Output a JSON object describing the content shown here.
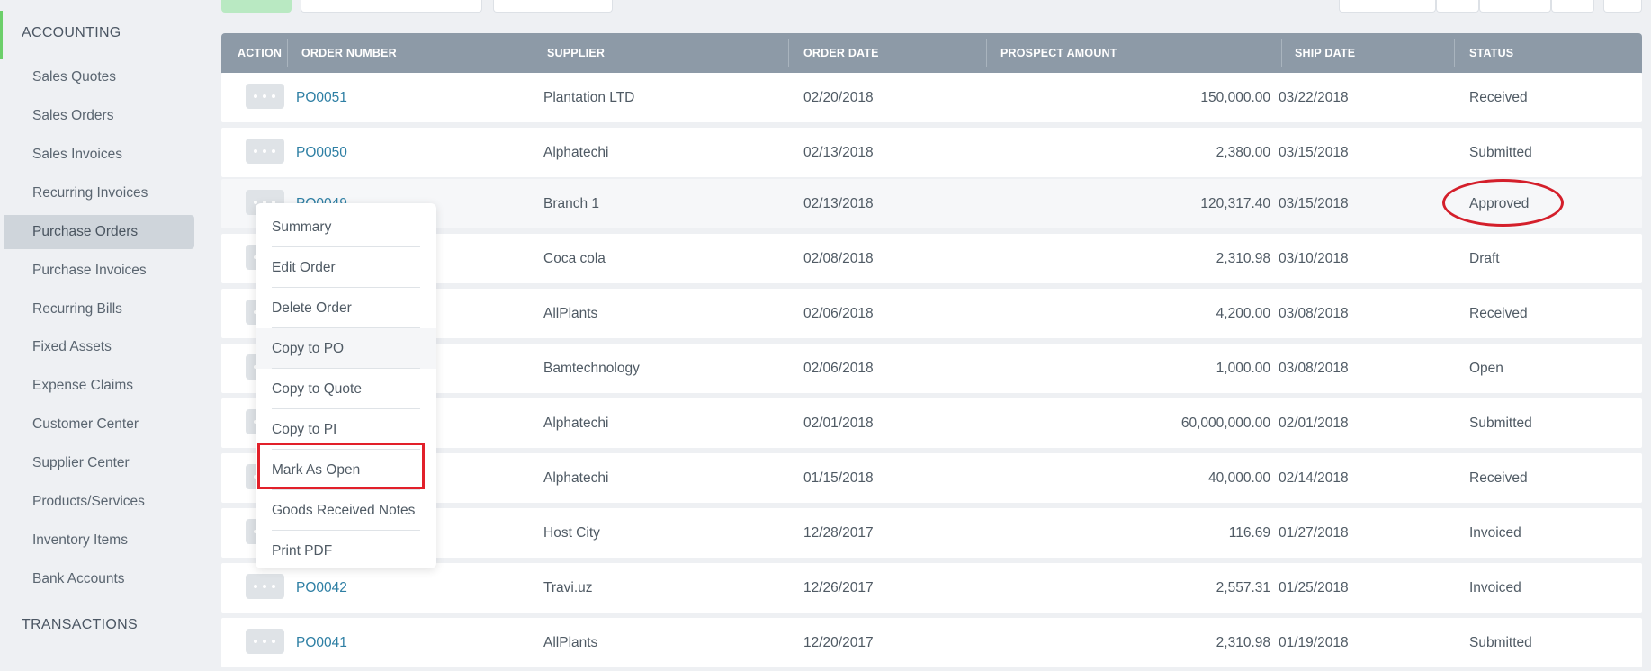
{
  "sidebar": {
    "section_accounting": "ACCOUNTING",
    "section_transactions": "TRANSACTIONS",
    "items": [
      {
        "label": "Sales Quotes"
      },
      {
        "label": "Sales Orders"
      },
      {
        "label": "Sales Invoices"
      },
      {
        "label": "Recurring Invoices"
      },
      {
        "label": "Purchase Orders",
        "active": true
      },
      {
        "label": "Purchase Invoices"
      },
      {
        "label": "Recurring Bills"
      },
      {
        "label": "Fixed Assets"
      },
      {
        "label": "Expense Claims"
      },
      {
        "label": "Customer Center"
      },
      {
        "label": "Supplier Center"
      },
      {
        "label": "Products/Services"
      },
      {
        "label": "Inventory Items"
      },
      {
        "label": "Bank Accounts"
      }
    ]
  },
  "table": {
    "columns": {
      "action": "ACTION",
      "order_number": "ORDER NUMBER",
      "supplier": "SUPPLIER",
      "order_date": "ORDER DATE",
      "prospect_amount": "PROSPECT AMOUNT",
      "ship_date": "SHIP DATE",
      "status": "STATUS"
    },
    "rows": [
      {
        "order": "PO0051",
        "supplier": "Plantation LTD",
        "order_date": "02/20/2018",
        "amount": "150,000.00",
        "ship_date": "03/22/2018",
        "status": "Received"
      },
      {
        "order": "PO0050",
        "supplier": "Alphatechi",
        "order_date": "02/13/2018",
        "amount": "2,380.00",
        "ship_date": "03/15/2018",
        "status": "Submitted"
      },
      {
        "order": "PO0049",
        "supplier": "Branch 1",
        "order_date": "02/13/2018",
        "amount": "120,317.40",
        "ship_date": "03/15/2018",
        "status": "Approved"
      },
      {
        "order": "",
        "supplier": "Coca cola",
        "order_date": "02/08/2018",
        "amount": "2,310.98",
        "ship_date": "03/10/2018",
        "status": "Draft"
      },
      {
        "order": "",
        "supplier": "AllPlants",
        "order_date": "02/06/2018",
        "amount": "4,200.00",
        "ship_date": "03/08/2018",
        "status": "Received"
      },
      {
        "order": "",
        "supplier": "Bamtechnology",
        "order_date": "02/06/2018",
        "amount": "1,000.00",
        "ship_date": "03/08/2018",
        "status": "Open"
      },
      {
        "order": "",
        "supplier": "Alphatechi",
        "order_date": "02/01/2018",
        "amount": "60,000,000.00",
        "ship_date": "02/01/2018",
        "status": "Submitted"
      },
      {
        "order": "",
        "supplier": "Alphatechi",
        "order_date": "01/15/2018",
        "amount": "40,000.00",
        "ship_date": "02/14/2018",
        "status": "Received"
      },
      {
        "order": "",
        "supplier": "Host City",
        "order_date": "12/28/2017",
        "amount": "116.69",
        "ship_date": "01/27/2018",
        "status": "Invoiced"
      },
      {
        "order": "PO0042",
        "supplier": "Travi.uz",
        "order_date": "12/26/2017",
        "amount": "2,557.31",
        "ship_date": "01/25/2018",
        "status": "Invoiced"
      },
      {
        "order": "PO0041",
        "supplier": "AllPlants",
        "order_date": "12/20/2017",
        "amount": "2,310.98",
        "ship_date": "01/19/2018",
        "status": "Submitted"
      }
    ]
  },
  "context_menu": {
    "items": [
      {
        "label": "Summary"
      },
      {
        "label": "Edit Order"
      },
      {
        "label": "Delete Order"
      },
      {
        "label": "Copy to PO"
      },
      {
        "label": "Copy to Quote"
      },
      {
        "label": "Copy to PI"
      },
      {
        "label": "Mark As Open"
      },
      {
        "label": "Goods Received Notes"
      },
      {
        "label": "Print PDF"
      }
    ]
  },
  "colors": {
    "header_bg": "#8d9aa7",
    "link": "#2e7fa4",
    "annotation_red": "#e2202a",
    "accent_green": "#6ccf6a"
  }
}
